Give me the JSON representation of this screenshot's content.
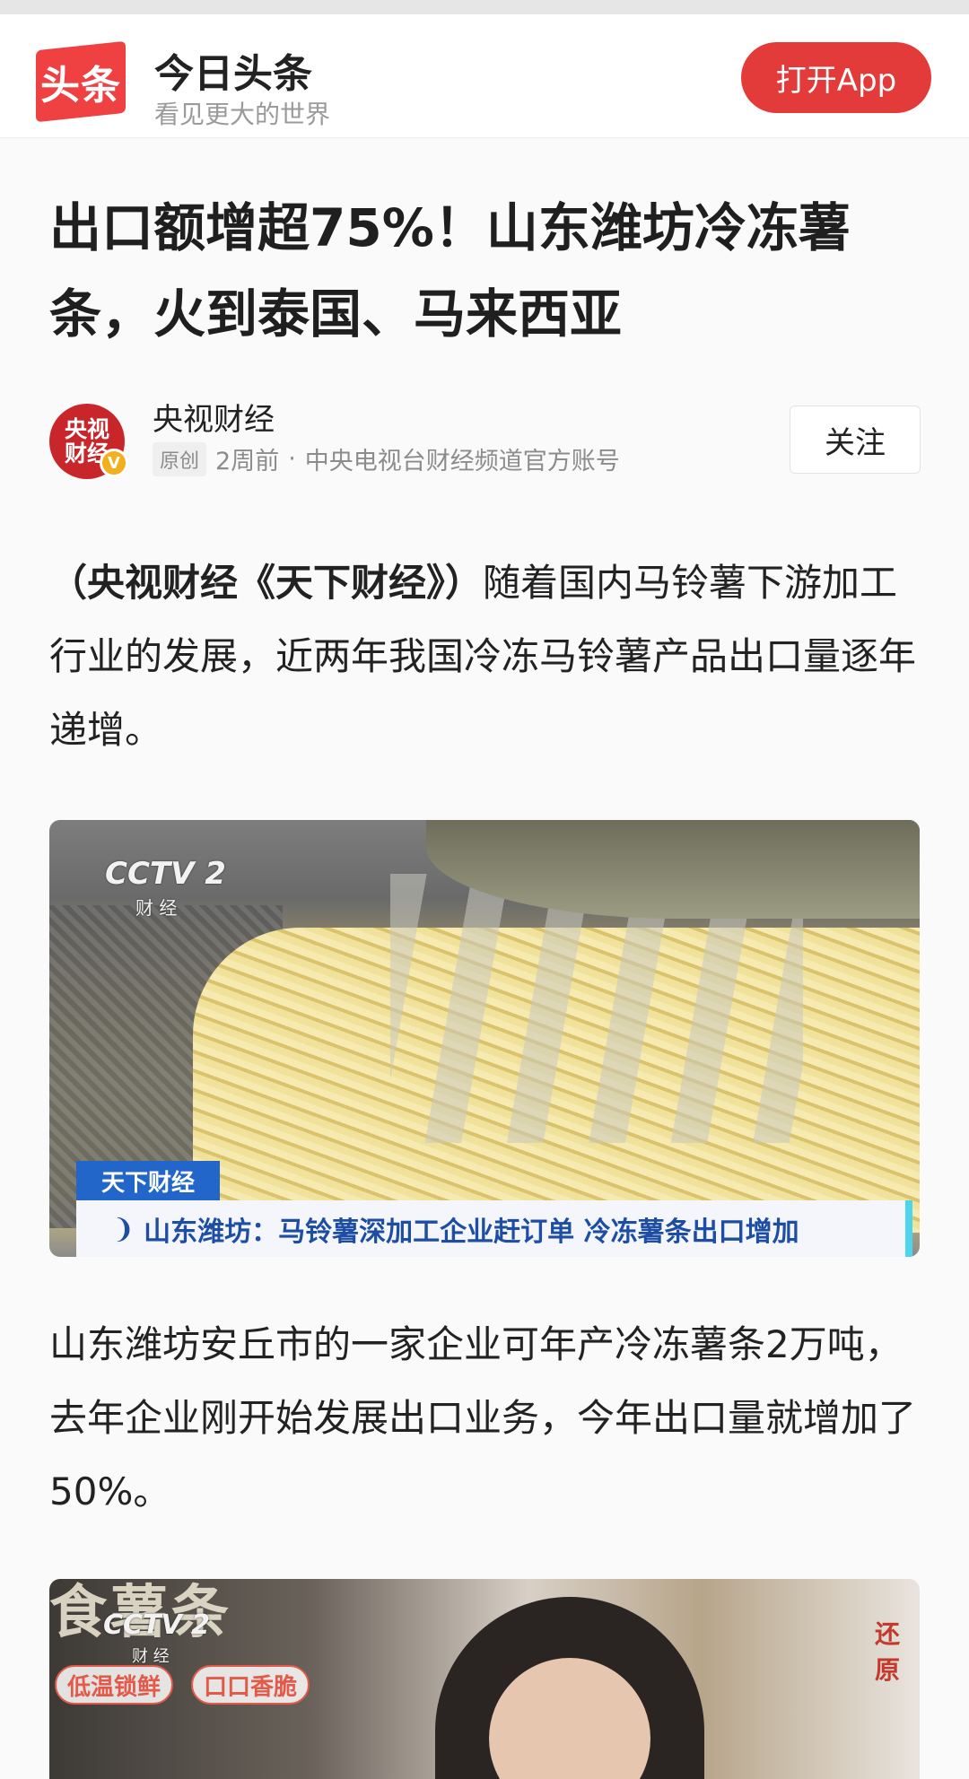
{
  "header": {
    "logo_text": "头条",
    "app_name": "今日头条",
    "slogan": "看见更大的世界",
    "open_app_label": "打开App"
  },
  "article": {
    "title": "出口额增超75%！山东潍坊冷冻薯条，火到泰国、马来西亚",
    "author": {
      "avatar_line1": "央视",
      "avatar_line2": "财经",
      "verified_mark": "V",
      "name": "央视财经",
      "tag": "原创",
      "time": "2周前",
      "separator": "·",
      "description": "中央电视台财经频道官方账号",
      "follow_label": "关注"
    },
    "paragraph1_bold": "（央视财经《天下财经》）",
    "paragraph1_rest": "随着国内马铃薯下游加工行业的发展，近两年我国冷冻马铃薯产品出口量逐年递增。",
    "image1": {
      "channel_logo": "CCTV 2",
      "channel_sub": "财 经",
      "program": "天下财经",
      "caption": "山东潍坊：马铃薯深加工企业赶订单 冷冻薯条出口增加"
    },
    "paragraph2": "山东潍坊安丘市的一家企业可年产冷冻薯条2万吨，去年企业刚开始发展出口业务，今年出口量就增加了50%。",
    "image2": {
      "bg_text": "食薯条",
      "channel_logo": "CCTV 2",
      "channel_sub": "财 经",
      "badge1": "低温锁鲜",
      "badge2": "口口香脆",
      "side_text": "还原"
    }
  },
  "colors": {
    "brand_red": "#f04142",
    "button_red": "#e23b3a",
    "caption_blue": "#1d4ea3",
    "program_blue": "#2366c9"
  }
}
